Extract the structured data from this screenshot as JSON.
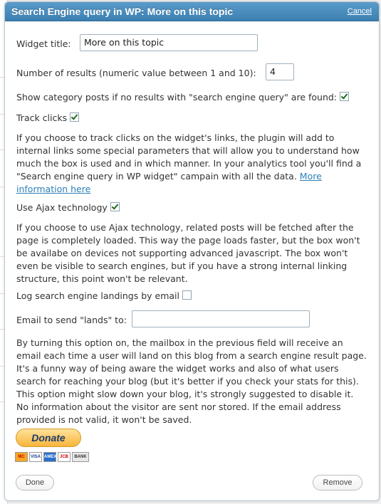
{
  "dialog": {
    "title": "Search Engine query in WP: More on this topic",
    "cancel_label": "Cancel"
  },
  "form": {
    "widget_title_label": "Widget title:",
    "widget_title_value": "More on this topic",
    "num_results_label": "Number of results (numeric value between 1 and 10):",
    "num_results_value": "4",
    "show_category_label": "Show category posts if no results with \"search engine query\" are found:",
    "show_category_checked": true,
    "track_clicks_label": "Track clicks",
    "track_clicks_checked": true,
    "track_clicks_desc": "If you choose to track clicks on the widget's links, the plugin will add to internal links some special parameters that will allow you to understand how much the box is used and in which manner. In your analytics tool you'll find a \"Search engine query in WP widget\" campain with all the data.",
    "more_info_link": "More information here",
    "ajax_label": "Use Ajax technology",
    "ajax_checked": true,
    "ajax_desc": "If you choose to use Ajax technology, related posts will be fetched after the page is completely loaded. This way the page loads faster, but the box won't be availabe on devices not supporting advanced javascript. The box won't even be visible to search engines, but if you have a strong internal linking structure, this point won't be relevant.",
    "log_label": "Log search engine landings by email",
    "log_checked": false,
    "email_label": "Email to send \"lands\" to:",
    "email_value": "",
    "email_desc": "By turning this option on, the mailbox in the previous field will receive an email each time a user will land on this blog from a search engine result page. It's a funny way of being aware the widget works and also of what users search for reaching your blog (but it's better if you check your stats for this). This option might slow down your blog, it's strongly suggested to disable it. No information about the visitor are sent nor stored. If the email address provided is not valid, it won't be saved."
  },
  "donate": {
    "label": "Donate",
    "cards": [
      "MC",
      "VISA",
      "AMEX",
      "JCB",
      "BANK"
    ]
  },
  "footer": {
    "done_label": "Done",
    "remove_label": "Remove"
  },
  "colors": {
    "titlebar": "#3b7fb1",
    "link": "#2c7fb8",
    "check": "#1d6c1d"
  }
}
